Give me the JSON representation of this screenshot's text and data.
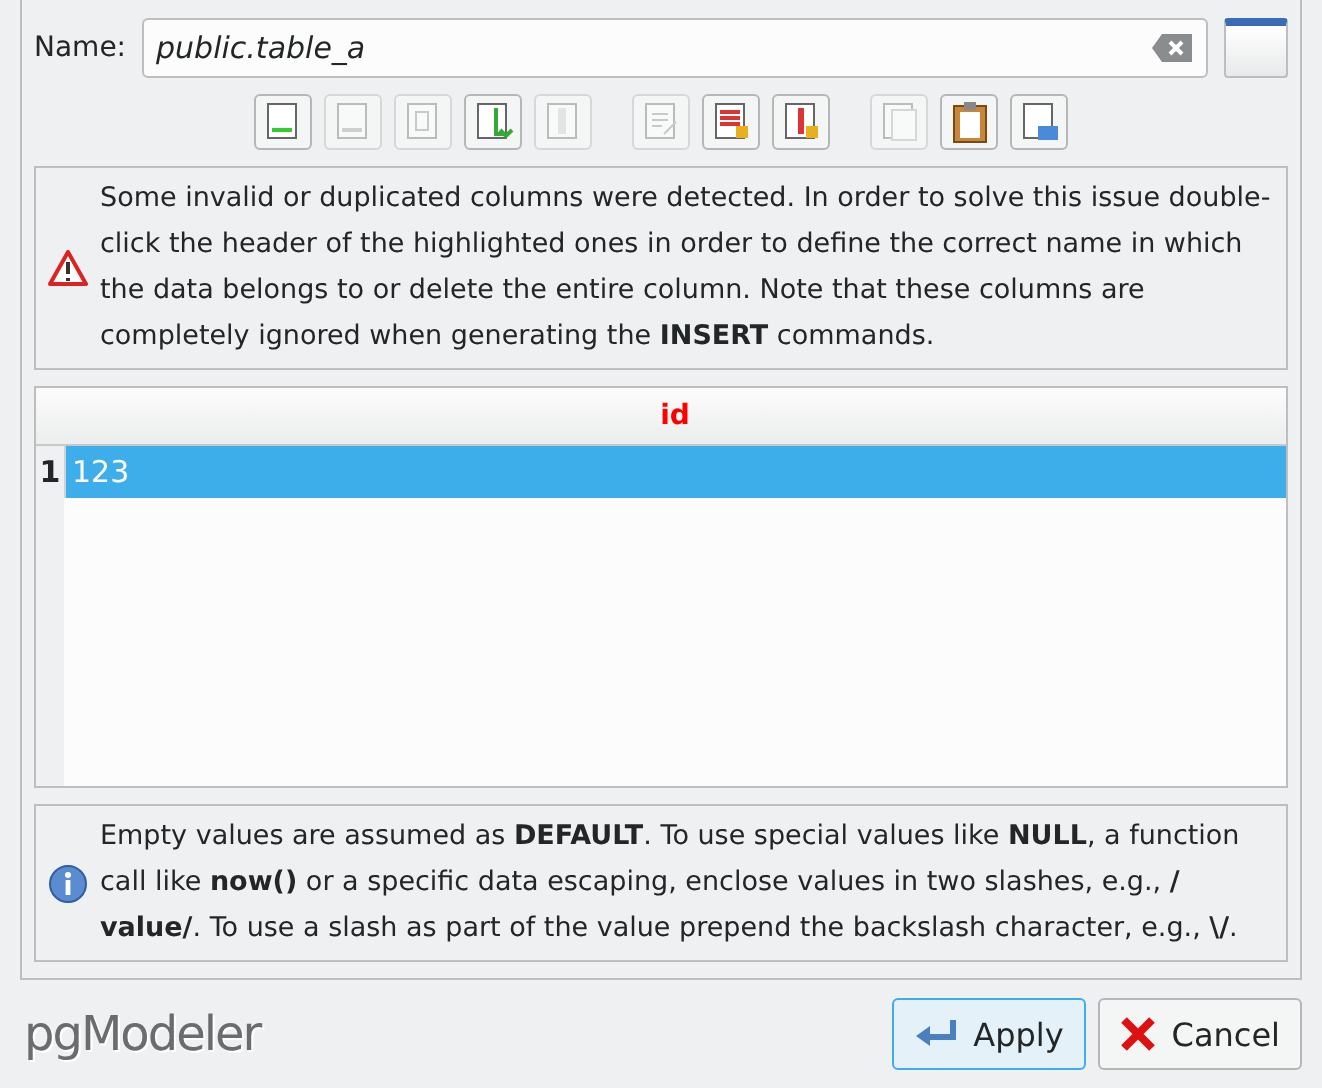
{
  "name_field": {
    "label": "Name:",
    "value": "public.table_a"
  },
  "toolbar_groups": [
    [
      {
        "kind": "add-row",
        "disabled": false
      },
      {
        "kind": "remove-row",
        "disabled": true
      },
      {
        "kind": "duplicate-row",
        "disabled": true
      },
      {
        "kind": "add-column",
        "disabled": false
      },
      {
        "kind": "remove-column",
        "disabled": true
      }
    ],
    [
      {
        "kind": "edit",
        "disabled": true
      },
      {
        "kind": "clear-rows",
        "disabled": false
      },
      {
        "kind": "clear-columns",
        "disabled": false
      }
    ],
    [
      {
        "kind": "copy",
        "disabled": true
      },
      {
        "kind": "paste",
        "disabled": false
      },
      {
        "kind": "import",
        "disabled": false
      }
    ]
  ],
  "warning": "Some invalid or duplicated columns were detected. In order to solve this issue double-click the header of the highlighted ones in order to define the correct name in which the data belongs to or delete the entire column. Note that these columns are completely ignored when generating the **INSERT** commands.",
  "table": {
    "columns": [
      {
        "label": "id",
        "invalid": true
      }
    ],
    "rows": [
      {
        "number": "1",
        "cells": [
          "123"
        ],
        "selected": true
      }
    ]
  },
  "info": "Empty values are assumed as **DEFAULT**. To use special values like **NULL**, a function call like **now()** or a specific data escaping, enclose values in two slashes, e.g., **/ value/**. To use a slash as part of the value prepend the backslash character, e.g., **\\/**.",
  "logo": "pgModeler",
  "buttons": [
    {
      "kind": "apply",
      "label": "Apply"
    },
    {
      "kind": "cancel",
      "label": "Cancel"
    }
  ]
}
